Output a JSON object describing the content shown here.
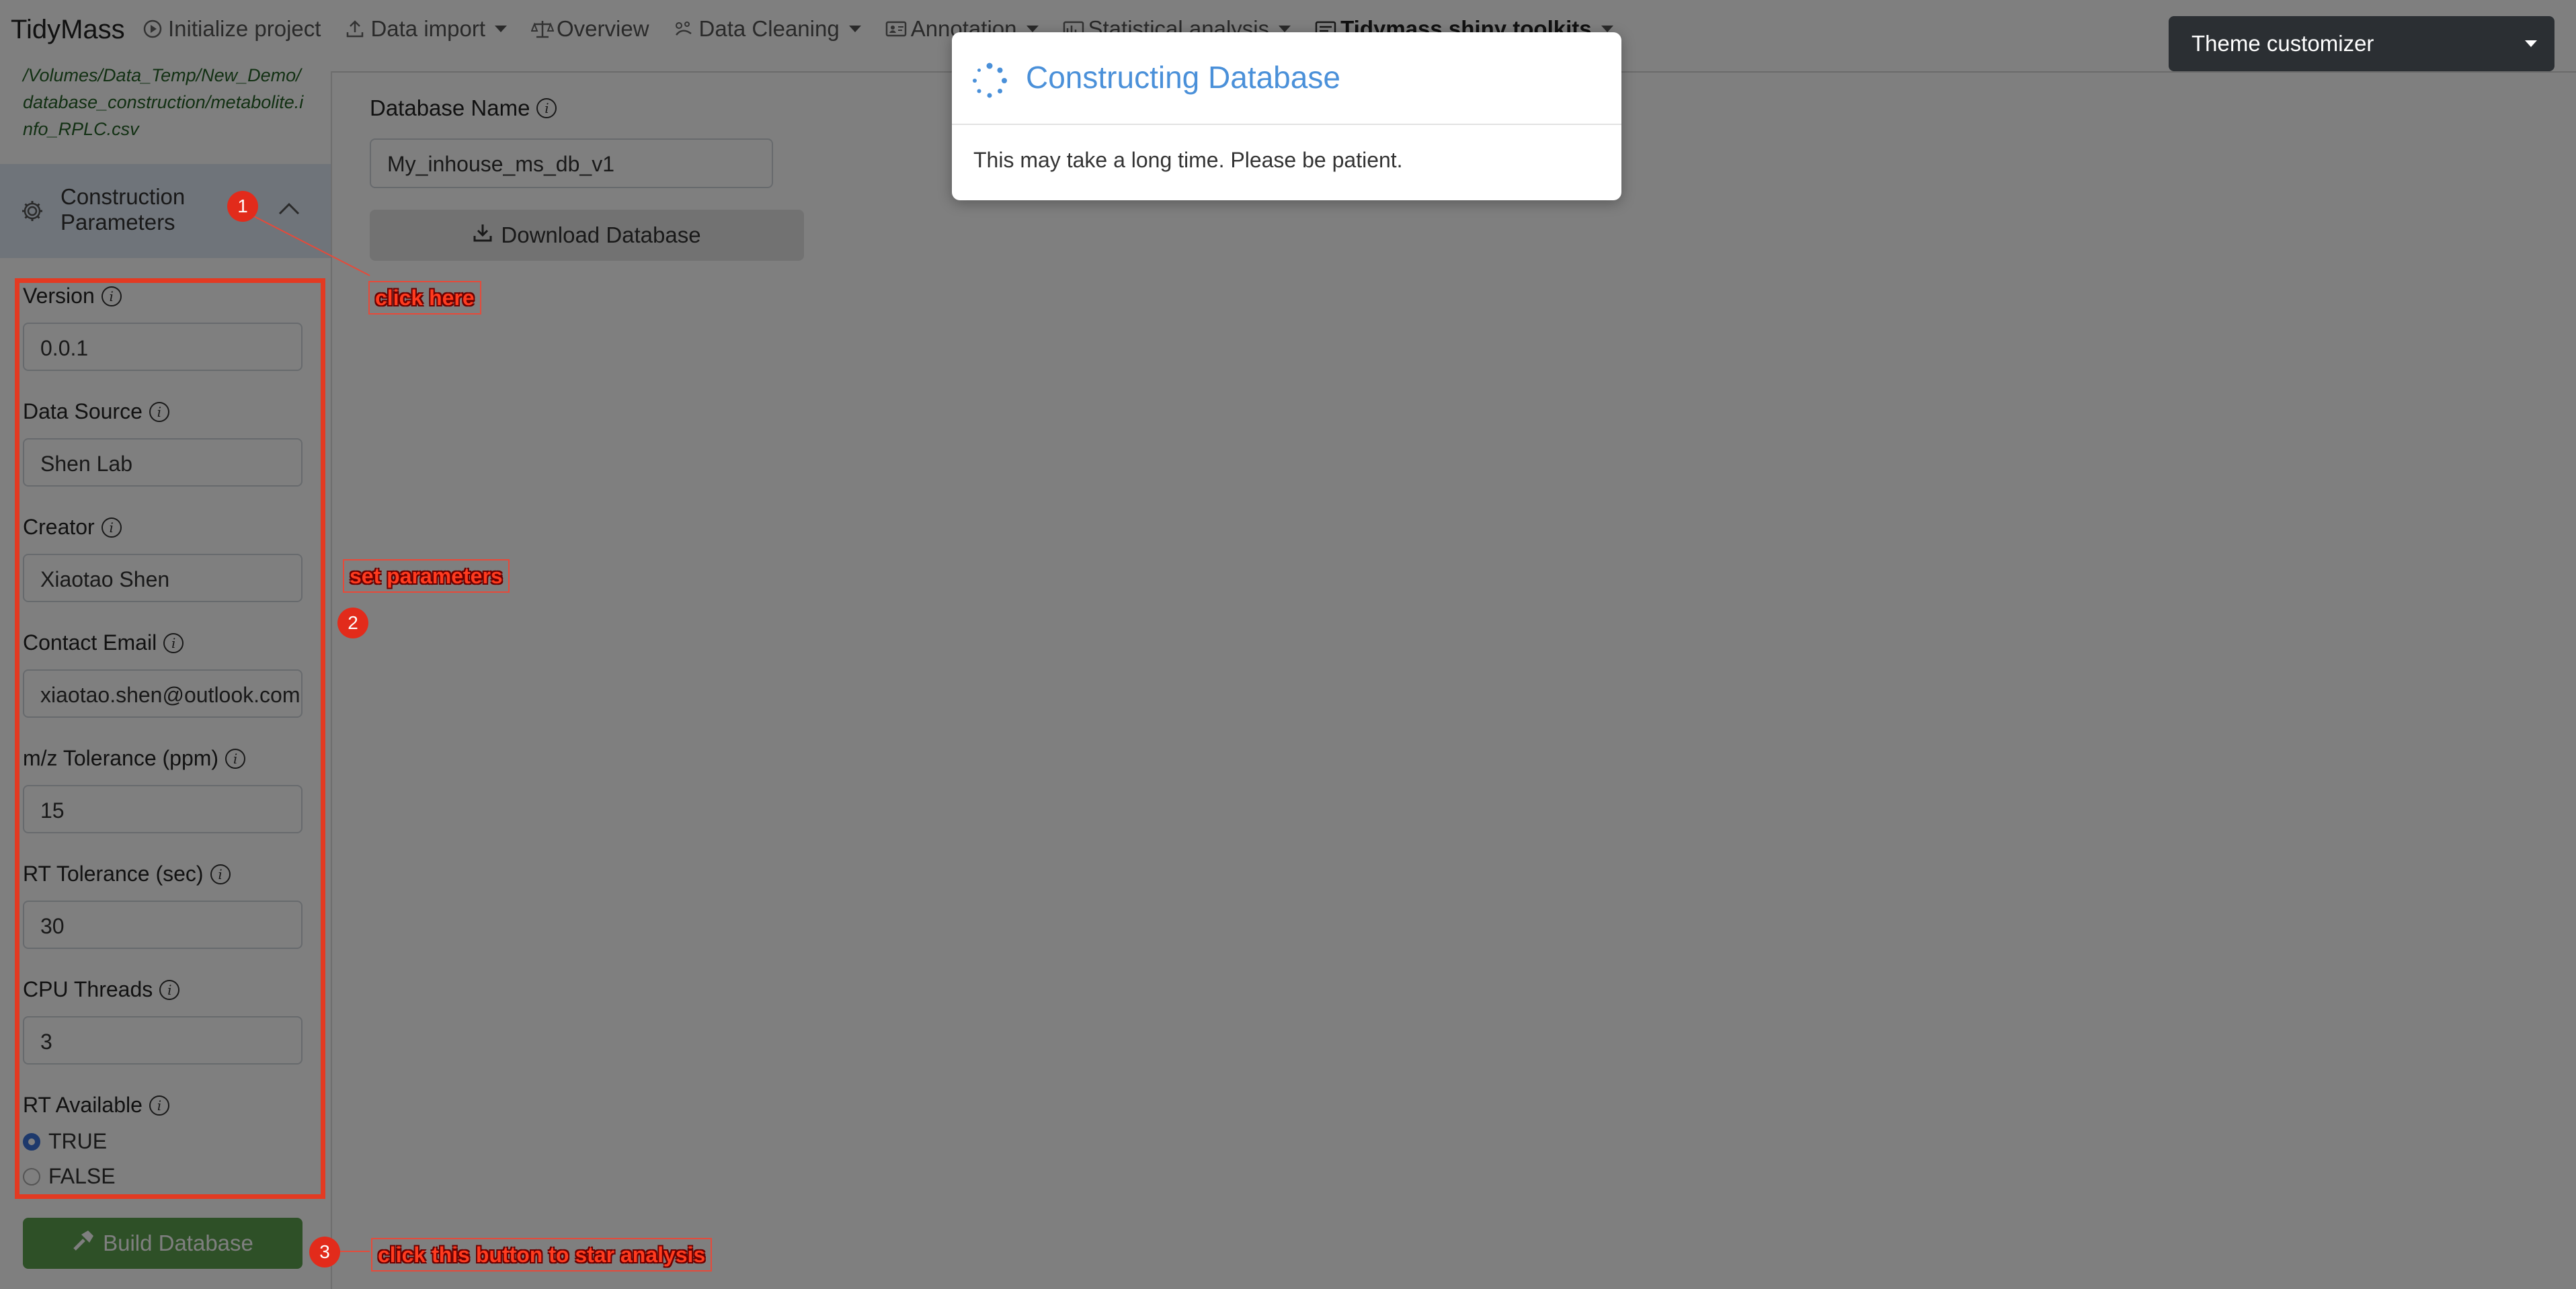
{
  "navbar": {
    "brand": "TidyMass",
    "items": [
      {
        "label": "Initialize project",
        "icon": "play-circle-icon",
        "dropdown": false
      },
      {
        "label": "Data import",
        "icon": "upload-icon",
        "dropdown": true
      },
      {
        "label": "Overview",
        "icon": "balance-scale-icon",
        "dropdown": false
      },
      {
        "label": "Data Cleaning",
        "icon": "clean-icon",
        "dropdown": true
      },
      {
        "label": "Annotation",
        "icon": "id-card-icon",
        "dropdown": true
      },
      {
        "label": "Statistical analysis",
        "icon": "chart-icon",
        "dropdown": true
      },
      {
        "label": "Tidymass shiny toolkits",
        "icon": "toolkit-icon",
        "dropdown": true
      }
    ]
  },
  "sidebar": {
    "file_path": "/Volumes/Data_Temp/New_Demo/database_construction/metabolite.info_RPLC.csv",
    "section_title": "Construction Parameters",
    "fields": [
      {
        "label": "Version",
        "value": "0.0.1"
      },
      {
        "label": "Data Source",
        "value": "Shen Lab"
      },
      {
        "label": "Creator",
        "value": "Xiaotao Shen"
      },
      {
        "label": "Contact Email",
        "value": "xiaotao.shen@outlook.com"
      },
      {
        "label": "m/z Tolerance (ppm)",
        "value": "15"
      },
      {
        "label": "RT Tolerance (sec)",
        "value": "30"
      },
      {
        "label": "CPU Threads",
        "value": "3"
      }
    ],
    "rt_available": {
      "label": "RT Available",
      "options": [
        "TRUE",
        "FALSE"
      ],
      "selected": "TRUE"
    },
    "build_button": "Build Database"
  },
  "main": {
    "db_name_label": "Database Name",
    "db_name_value": "My_inhouse_ms_db_v1",
    "download_button": "Download Database"
  },
  "modal": {
    "title": "Constructing Database",
    "body": "This may take a long time. Please be patient."
  },
  "theme_customizer": {
    "label": "Theme customizer"
  },
  "annotations": {
    "step1": {
      "number": "1",
      "text": "click here"
    },
    "step2": {
      "number": "2",
      "text": "set parameters"
    },
    "step3": {
      "number": "3",
      "text": "click this button to star analysis"
    }
  },
  "colors": {
    "accent": "#4a90d9",
    "annotation": "#e33a22",
    "build_button": "#5da04f",
    "path_text": "#256126"
  }
}
